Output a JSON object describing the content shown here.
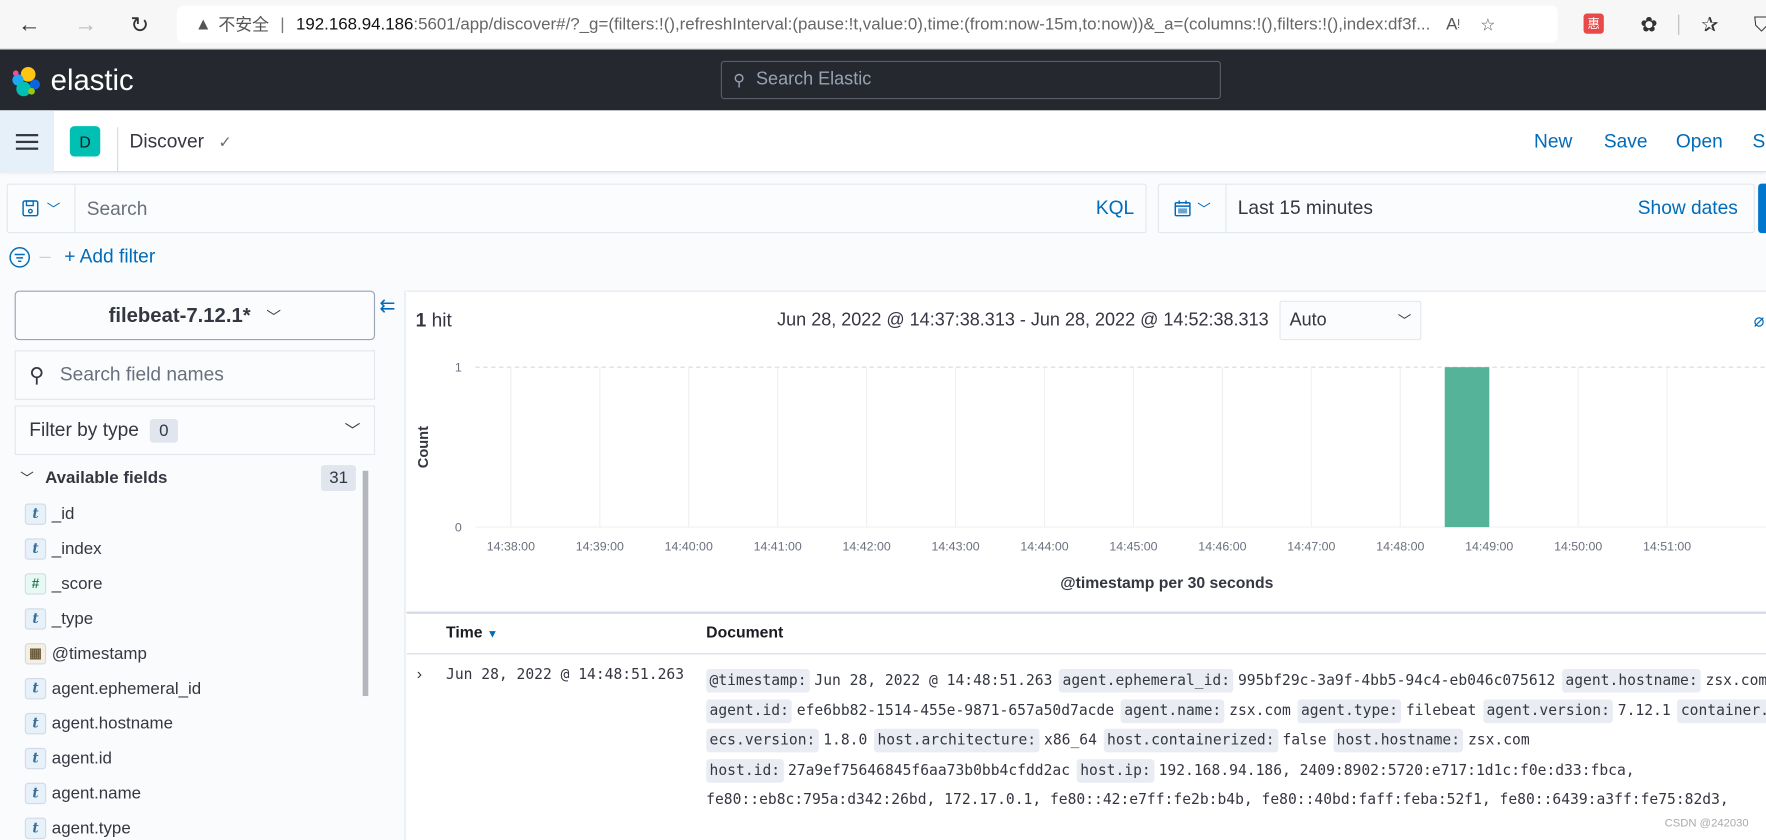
{
  "browser": {
    "insecure_label": "不安全",
    "url_host": "192.168.94.186",
    "url_rest": ":5601/app/discover#/?_g=(filters:!(),refreshInterval:(pause:!t,value:0),time:(from:now-15m,to:now))&_a=(columns:!(),filters:!(),index:df3f...",
    "ext_label": "惠"
  },
  "header": {
    "logo_text": "elastic",
    "search_placeholder": "Search Elastic"
  },
  "appbar": {
    "space_initial": "D",
    "app_name": "Discover",
    "links": [
      "New",
      "Save",
      "Open",
      "Sh"
    ]
  },
  "query": {
    "placeholder": "Search",
    "language": "KQL",
    "time_range": "Last 15 minutes",
    "show_dates": "Show dates",
    "add_filter": "+ Add filter"
  },
  "sidebar": {
    "index_pattern": "filebeat-7.12.1*",
    "search_placeholder": "Search field names",
    "filter_type_label": "Filter by type",
    "filter_type_count": "0",
    "available_label": "Available fields",
    "available_count": "31",
    "fields": [
      {
        "name": "_id",
        "type": "t"
      },
      {
        "name": "_index",
        "type": "t"
      },
      {
        "name": "_score",
        "type": "#"
      },
      {
        "name": "_type",
        "type": "t"
      },
      {
        "name": "@timestamp",
        "type": "date"
      },
      {
        "name": "agent.ephemeral_id",
        "type": "t"
      },
      {
        "name": "agent.hostname",
        "type": "t"
      },
      {
        "name": "agent.id",
        "type": "t"
      },
      {
        "name": "agent.name",
        "type": "t"
      },
      {
        "name": "agent.type",
        "type": "t"
      }
    ]
  },
  "results": {
    "hits_count": "1",
    "hits_label": "hit",
    "date_range": "Jun 28, 2022 @ 14:37:38.313 - Jun 28, 2022 @ 14:52:38.313",
    "interval": "Auto"
  },
  "chart_data": {
    "type": "bar",
    "title": "",
    "xlabel": "@timestamp per 30 seconds",
    "ylabel": "Count",
    "ylim": [
      0,
      1
    ],
    "yticks": [
      "0",
      "1"
    ],
    "x_range_minutes": [
      37.6,
      51.8
    ],
    "xticks": [
      "14:38:00",
      "14:39:00",
      "14:40:00",
      "14:41:00",
      "14:42:00",
      "14:43:00",
      "14:44:00",
      "14:45:00",
      "14:46:00",
      "14:47:00",
      "14:48:00",
      "14:49:00",
      "14:50:00",
      "14:51:00"
    ],
    "bars": [
      {
        "start": "14:48:30",
        "end": "14:49:00",
        "value": 1
      }
    ],
    "color": "#54b399",
    "grid": true
  },
  "table": {
    "col_time": "Time",
    "col_document": "Document",
    "rows": [
      {
        "time": "Jun 28, 2022 @ 14:48:51.263",
        "lines": [
          [
            [
              "@timestamp:",
              "Jun 28, 2022 @ 14:48:51.263"
            ],
            [
              "agent.ephemeral_id:",
              "995bf29c-3a9f-4bb5-94c4-eb046c075612"
            ],
            [
              "agent.hostname:",
              "zsx.com"
            ]
          ],
          [
            [
              "agent.id:",
              "efe6bb82-1514-455e-9871-657a50d7acde"
            ],
            [
              "agent.name:",
              "zsx.com"
            ],
            [
              "agent.type:",
              "filebeat"
            ],
            [
              "agent.version:",
              "7.12.1"
            ],
            [
              "container.id:",
              ""
            ]
          ],
          [
            [
              "ecs.version:",
              "1.8.0"
            ],
            [
              "host.architecture:",
              "x86_64"
            ],
            [
              "host.containerized:",
              "false"
            ],
            [
              "host.hostname:",
              "zsx.com"
            ]
          ],
          [
            [
              "host.id:",
              "27a9ef75646845f6aa73b0bb4cfdd2ac"
            ],
            [
              "host.ip:",
              "192.168.94.186, 2409:8902:5720:e717:1d1c:f0e:d33:fbca,"
            ]
          ],
          [
            [
              "",
              "fe80::eb8c:795a:d342:26bd, 172.17.0.1, fe80::42:e7ff:fe2b:b4b, fe80::40bd:faff:feba:52f1, fe80::6439:a3ff:fe75:82d3,"
            ]
          ]
        ]
      }
    ]
  },
  "watermark": "CSDN @242030"
}
